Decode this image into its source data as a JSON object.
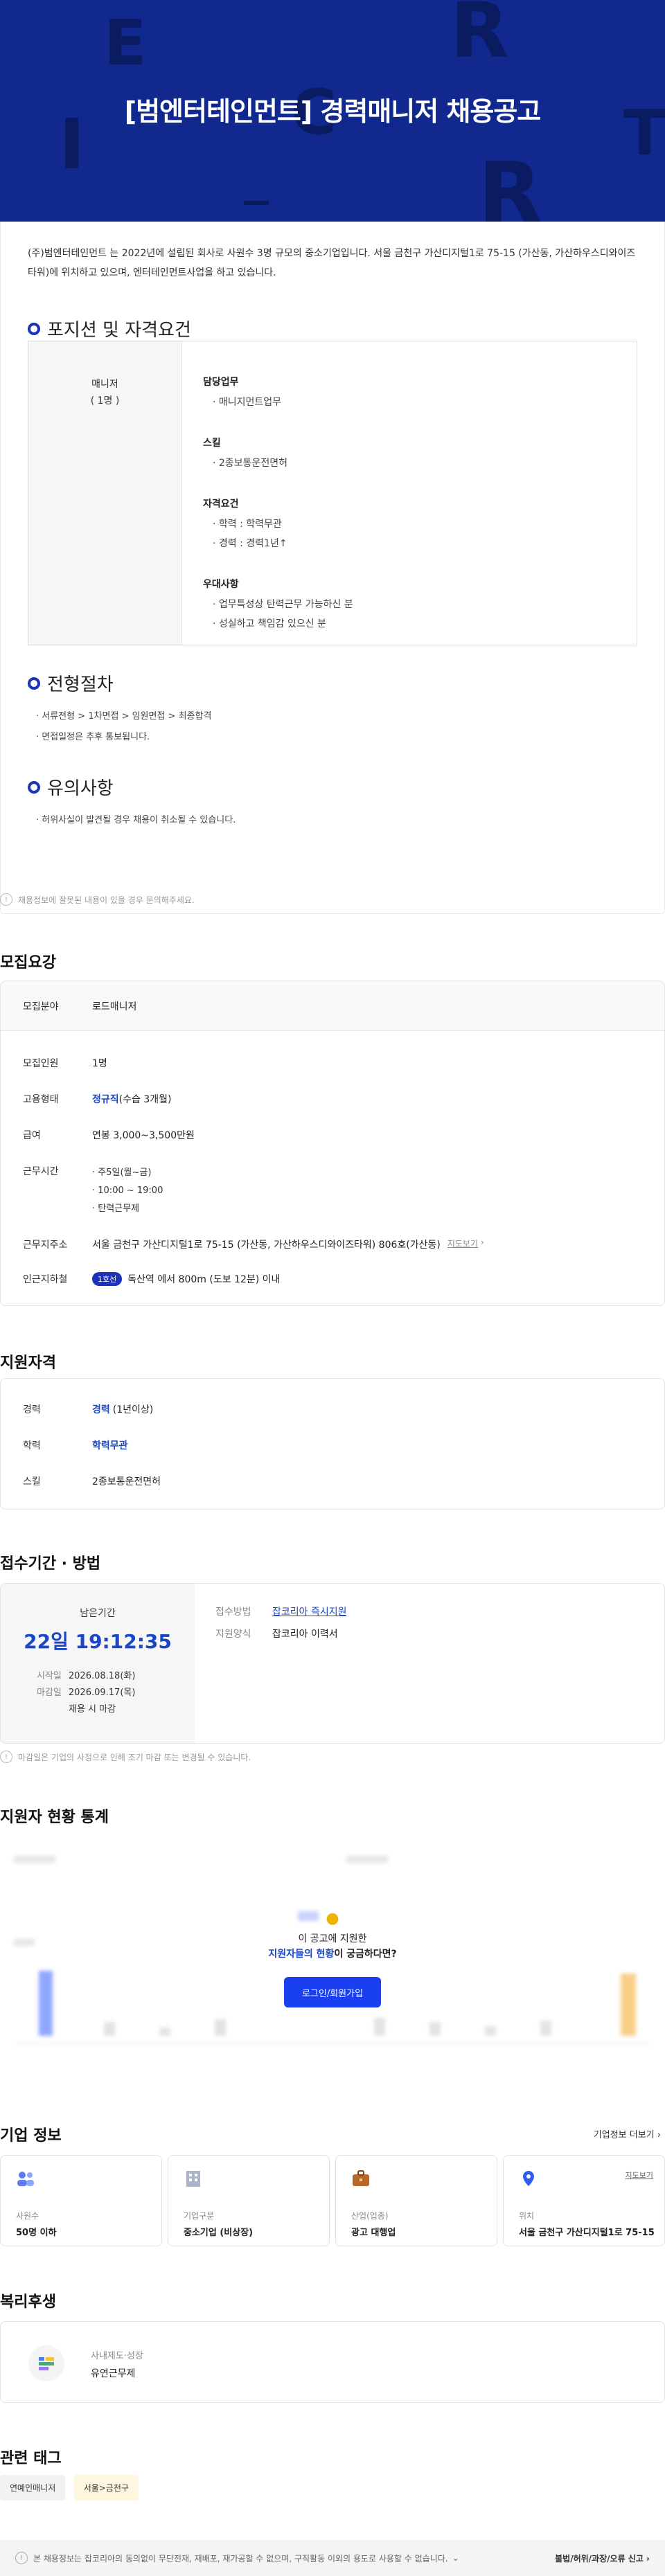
{
  "hero": {
    "title": "[범엔터테인먼트] 경력매니저 채용공고",
    "letters": [
      "E",
      "R",
      "C",
      "I",
      "R",
      "T"
    ]
  },
  "intro": "(주)범엔터테인먼트 는 2022년에 설립된 회사로 사원수 3명 규모의 중소기업입니다. 서울 금천구 가산디지털1로 75-15 (가산동, 가산하우스디와이즈타워)에 위치하고 있으며, 엔터테인먼트사업을 하고 있습니다.",
  "position": {
    "heading": "포지션 및 자격요건",
    "role": "매니저",
    "count": "( 1명 )",
    "duties_h": "담당업무",
    "duties": [
      "· 매니지먼트업무"
    ],
    "skills_h": "스킬",
    "skills": [
      "· 2종보통운전면허"
    ],
    "qual_h": "자격요건",
    "quals": [
      "· 학력 : 학력무관",
      "· 경력 : 경력1년↑"
    ],
    "pref_h": "우대사항",
    "prefs": [
      "· 업무특성상 탄력근무 가능하신 분",
      "· 성실하고 책임감 있으신 분"
    ]
  },
  "process": {
    "heading": "전형절차",
    "items": [
      "· 서류전형 > 1차면접 > 임원면접 > 최종합격",
      "· 면접일정은 추후 통보됩니다."
    ]
  },
  "caution": {
    "heading": "유의사항",
    "items": [
      "· 허위사실이 발견될 경우 채용이 취소될 수 있습니다."
    ]
  },
  "notice": "채용정보에 잘못된 내용이 있을 경우 문의해주세요.",
  "recruit": {
    "heading": "모집요강",
    "field_k": "모집분야",
    "field_v": "로드매니저",
    "count_k": "모집인원",
    "count_v": "1명",
    "type_k": "고용형태",
    "type_link": "정규직",
    "type_v": "(수습 3개월)",
    "salary_k": "급여",
    "salary_v": "연봉 3,000~3,500만원",
    "hours_k": "근무시간",
    "hours": [
      "주5일(월~금)",
      "10:00 ~ 19:00",
      "탄력근무제"
    ],
    "addr_k": "근무지주소",
    "addr_v": "서울 금천구 가산디지털1로 75-15 (가산동, 가산하우스디와이즈타워) 806호(가산동)",
    "map_link": "지도보기",
    "subway_k": "인근지하철",
    "subway_badge": "1호선",
    "subway_v": "독산역 에서 800m (도보 12분) 이내"
  },
  "qualify": {
    "heading": "지원자격",
    "exp_k": "경력",
    "exp_link": "경력",
    "exp_v": "(1년이상)",
    "edu_k": "학력",
    "edu_link": "학력무관",
    "skill_k": "스킬",
    "skill_v": "2종보통운전면허"
  },
  "apply": {
    "heading": "접수기간 · 방법",
    "remain_label": "남은기간",
    "remain": "22일 19:12:35",
    "start_k": "시작일",
    "start_v": "2026.08.18(화)",
    "end_k": "마감일",
    "end_v": "2026.09.17(목)",
    "end_note": "채용 시 마감",
    "method_k": "접수방법",
    "method_link": "잡코리아 즉시지원",
    "form_k": "지원양식",
    "form_v": "잡코리아 이력서",
    "note": "마감일은 기업의 사정으로 인해 조기 마감 또는 변경될 수 있습니다."
  },
  "stats": {
    "heading": "지원자 현황 통계",
    "prompt1": "이 공고에 지원한",
    "prompt_link": "지원자들의 현황",
    "prompt2": "이 궁금하다면?",
    "login_btn": "로그인/회원가입"
  },
  "company": {
    "heading": "기업 정보",
    "more": "기업정보 더보기",
    "cards": [
      {
        "label": "사원수",
        "value": "50명 이하"
      },
      {
        "label": "기업구분",
        "value": "중소기업 (비상장)"
      },
      {
        "label": "산업(업종)",
        "value": "광고 대행업"
      },
      {
        "label": "위치",
        "value": "서울 금천구 가산디지털1로 75-15"
      }
    ],
    "map_link": "지도보기"
  },
  "welfare": {
    "heading": "복리후생",
    "category": "사내제도·성장",
    "item": "유연근무제"
  },
  "tags": {
    "heading": "관련 태그",
    "items": [
      "연예인매니저",
      "서울>금천구"
    ]
  },
  "footer": {
    "text": "본 채용정보는 잡코리아의 동의없이 무단전재, 재배포, 재가공할 수 없으며, 구직활동 이외의 용도로 사용할 수 없습니다.",
    "report": "불법/허위/과장/오류 신고"
  },
  "colors": {
    "hero_bg": "#11288f",
    "accent": "#1a33b8",
    "link": "#1a46c8",
    "remain": "#1a46c8",
    "login": "#1a3ff0"
  }
}
